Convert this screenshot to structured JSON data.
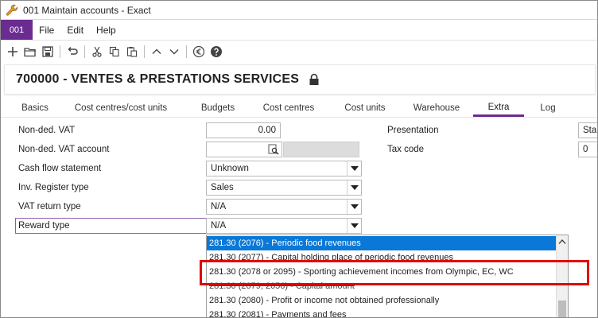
{
  "window": {
    "title": "001 Maintain accounts - Exact"
  },
  "menu": {
    "code": "001",
    "items": [
      "File",
      "Edit",
      "Help"
    ]
  },
  "toolbar": {
    "icons": [
      "plus-icon",
      "open-folder-icon",
      "save-icon",
      "undo-icon",
      "cut-icon",
      "copy-icon",
      "paste-icon",
      "chevron-up-icon",
      "chevron-down-icon",
      "euro-icon",
      "help-icon"
    ]
  },
  "header": {
    "account": "700000 - VENTES & PRESTATIONS SERVICES"
  },
  "tabs": [
    "Basics",
    "Cost centres/cost units",
    "Budgets",
    "Cost centres",
    "Cost units",
    "Warehouse",
    "Extra",
    "Log"
  ],
  "active_tab": "Extra",
  "form": {
    "non_ded_vat": {
      "label": "Non-ded. VAT",
      "value": "0.00"
    },
    "non_ded_vat_account": {
      "label": "Non-ded. VAT account",
      "value": ""
    },
    "cash_flow": {
      "label": "Cash flow statement",
      "value": "Unknown"
    },
    "inv_register": {
      "label": "Inv. Register type",
      "value": "Sales"
    },
    "vat_return": {
      "label": "VAT return type",
      "value": "N/A"
    },
    "reward_type": {
      "label": "Reward type",
      "value": "N/A"
    },
    "presentation": {
      "label": "Presentation",
      "value": "Stan"
    },
    "tax_code": {
      "label": "Tax code",
      "value": "0"
    }
  },
  "dropdown": {
    "items": [
      "281.30 (2076) - Periodic food revenues",
      "281.30 (2077) - Capital holding place of periodic food revenues",
      "281.30 (2078 or 2095) - Sporting achievement incomes from Olympic, EC, WC",
      "281.30 (2079, 2056) - Capital amount",
      "281.30 (2080) - Profit or income not obtained professionally",
      "281.30 (2081) - Payments and fees"
    ],
    "selected_index": 0
  },
  "colors": {
    "accent": "#6b2c91",
    "selection": "#0a78d7",
    "highlight": "#e10000"
  }
}
